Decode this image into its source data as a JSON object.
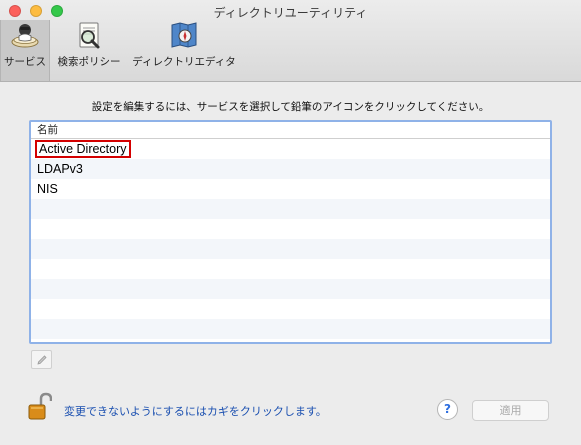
{
  "window": {
    "title": "ディレクトリユーティリティ"
  },
  "toolbar": {
    "items": [
      {
        "label": "サービス",
        "icon": "services-icon",
        "selected": true
      },
      {
        "label": "検索ポリシー",
        "icon": "search-policy-icon",
        "selected": false
      },
      {
        "label": "ディレクトリエディタ",
        "icon": "directory-editor-icon",
        "selected": false
      }
    ]
  },
  "main": {
    "instruction": "設定を編集するには、サービスを選択して鉛筆のアイコンをクリックしてください。",
    "table": {
      "column_header": "名前",
      "rows": [
        {
          "name": "Active Directory",
          "highlighted": true
        },
        {
          "name": "LDAPv3",
          "highlighted": false
        },
        {
          "name": "NIS",
          "highlighted": false
        }
      ]
    }
  },
  "footer": {
    "lock_text": "変更できないようにするにはカギをクリックします。",
    "help_label": "?",
    "apply_label": "適用"
  },
  "colors": {
    "highlight_border": "#d40000",
    "table_focus_ring": "#8fb2e8",
    "link_text": "#1a4fb0",
    "lock_gold": "#d98c1a"
  }
}
